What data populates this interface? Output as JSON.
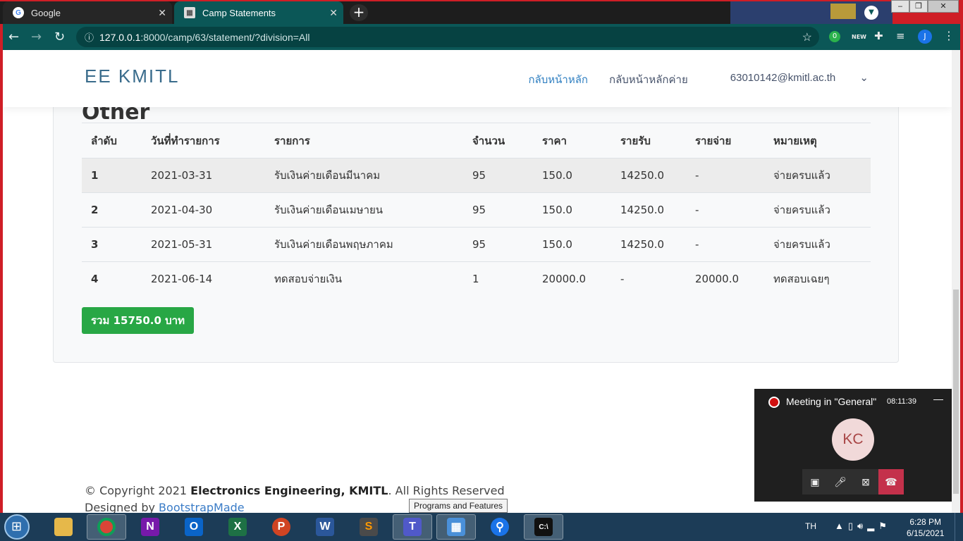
{
  "browser": {
    "tabs": [
      {
        "title": "Google",
        "favicon": "G"
      },
      {
        "title": "Camp Statements",
        "favicon": "▦"
      }
    ],
    "url_host": "127.0.0.1",
    "url_rest": ":8000/camp/63/statement/?division=All",
    "profile_initial": "J",
    "shield_badge": "0",
    "new_badge": "NEW"
  },
  "site": {
    "logo": "EE KMITL",
    "nav": {
      "home": "กลับหน้าหลัก",
      "camp_home": "กลับหน้าหลักค่าย",
      "user": "63010142@kmitl.ac.th"
    }
  },
  "statement": {
    "section_title": "Other",
    "columns": [
      "ลำดับ",
      "วันที่ทำรายการ",
      "รายการ",
      "จำนวน",
      "ราคา",
      "รายรับ",
      "รายจ่าย",
      "หมายเหตุ"
    ],
    "rows": [
      [
        "1",
        "2021-03-31",
        "รับเงินค่ายเดือนมีนาคม",
        "95",
        "150.0",
        "14250.0",
        "-",
        "จ่ายครบแล้ว"
      ],
      [
        "2",
        "2021-04-30",
        "รับเงินค่ายเดือนเมษายน",
        "95",
        "150.0",
        "14250.0",
        "-",
        "จ่ายครบแล้ว"
      ],
      [
        "3",
        "2021-05-31",
        "รับเงินค่ายเดือนพฤษภาคม",
        "95",
        "150.0",
        "14250.0",
        "-",
        "จ่ายครบแล้ว"
      ],
      [
        "4",
        "2021-06-14",
        "ทดสอบจ่ายเงิน",
        "1",
        "20000.0",
        "-",
        "20000.0",
        "ทดสอบเฉยๆ"
      ]
    ],
    "total_label": "รวม 15750.0 บาท"
  },
  "footer": {
    "copyright_prefix": "© Copyright 2021 ",
    "org": "Electronics Engineering, KMITL",
    "copyright_suffix": ". All Rights Reserved",
    "designed_by": "Designed by ",
    "designer": "BootstrapMade"
  },
  "teams": {
    "title": "Meeting in \"General\"",
    "timer": "08:11:39",
    "avatar_initials": "KC"
  },
  "tooltip": "Programs and Features",
  "taskbar": {
    "language": "TH",
    "time": "6:28 PM",
    "date": "6/15/2021",
    "apps": [
      "file-explorer",
      "chrome",
      "onenote",
      "outlook",
      "excel",
      "powerpoint",
      "word",
      "sublime-text",
      "teams",
      "control-panel",
      "maps",
      "command-prompt"
    ]
  },
  "colors": {
    "chrome_theme": "#0b5757",
    "window_frame": "#cf1e26",
    "total_button": "#28a745",
    "nav_active": "#2f7fc1"
  }
}
